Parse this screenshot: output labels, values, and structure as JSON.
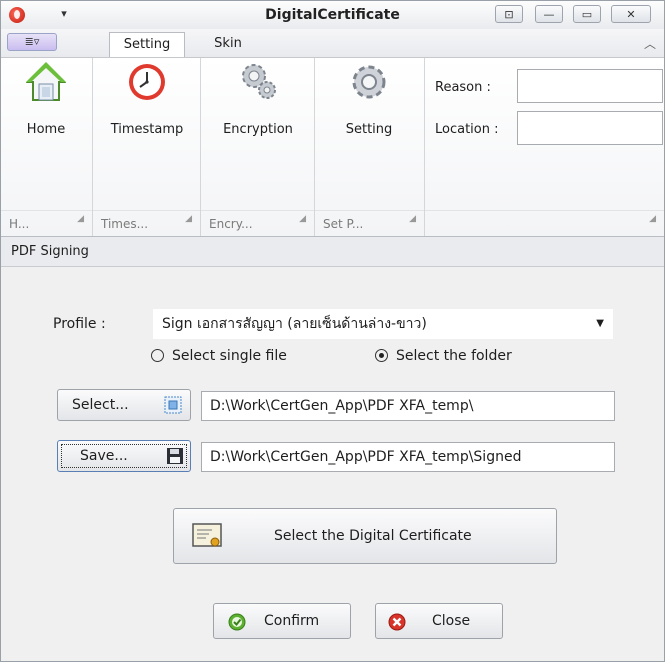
{
  "window": {
    "title": "DigitalCertificate",
    "qat_icon": "dropdown-arrow-icon",
    "controls": [
      "restore-icon",
      "minimize-icon",
      "maximize-icon",
      "close-icon"
    ]
  },
  "tabs": {
    "app_menu": "≣▿",
    "items": [
      {
        "label": "Setting",
        "active": true
      },
      {
        "label": "Skin",
        "active": false
      }
    ]
  },
  "ribbon": {
    "buttons": [
      {
        "label": "Home",
        "icon": "home-icon"
      },
      {
        "label": "Timestamp",
        "icon": "clock-icon"
      },
      {
        "label": "Encryption",
        "icon": "gears-icon"
      },
      {
        "label": "Setting",
        "icon": "gear-icon"
      }
    ],
    "groups": [
      "H...",
      "Times...",
      "Encry...",
      "Set P..."
    ],
    "reason_label": "Reason :",
    "location_label": "Location :",
    "reason_value": "",
    "location_value": ""
  },
  "section": {
    "title": "PDF Signing"
  },
  "form": {
    "profile_label": "Profile :",
    "profile_value": "Sign เอกสารสัญญา (ลายเซ็นด้านล่าง-ขาว)",
    "radio_single": "Select single file",
    "radio_folder": "Select the folder",
    "selected_radio": "folder",
    "select_button": "Select...",
    "save_button": "Save...",
    "select_path": "D:\\Work\\CertGen_App\\PDF XFA_temp\\",
    "save_path": "D:\\Work\\CertGen_App\\PDF XFA_temp\\Signed",
    "cert_button": "Select the Digital Certificate",
    "confirm_button": "Confirm",
    "close_button": "Close"
  },
  "colors": {
    "accent": "#2b5797",
    "confirm_green": "#5cb030",
    "close_red": "#d8342a"
  }
}
